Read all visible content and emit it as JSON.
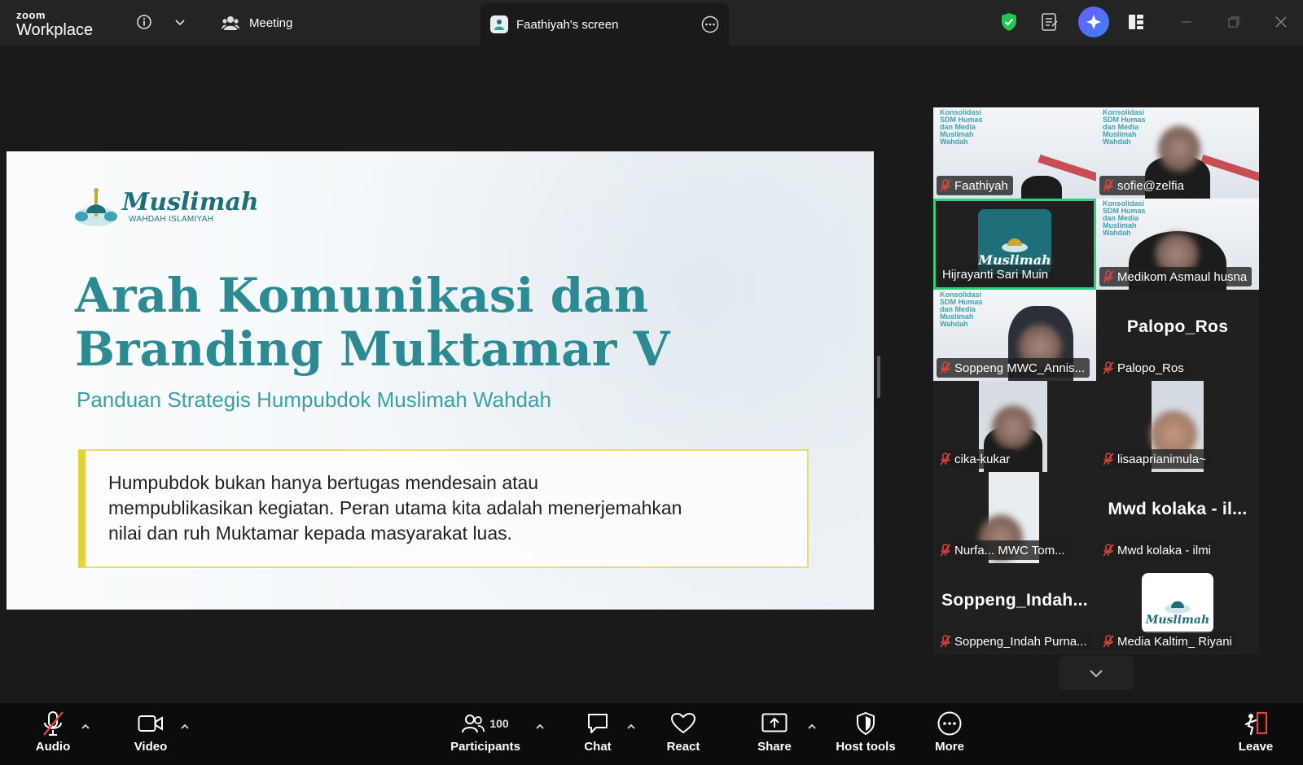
{
  "titlebar": {
    "brand_top": "zoom",
    "brand_bottom": "Workplace",
    "meeting_label": "Meeting",
    "screen_tab_label": "Faathiyah's screen"
  },
  "slide": {
    "logo_main": "Muslimah",
    "logo_sub": "WAHDAH ISLAMIYAH",
    "title_line1": "Arah Komunikasi dan",
    "title_line2": "Branding Muktamar V",
    "subtitle": "Panduan Strategis Humpubdok Muslimah Wahdah",
    "quote_line1": "Humpubdok bukan hanya bertugas mendesain atau",
    "quote_line2": "mempublikasikan kegiatan. Peran utama kita adalah menerjemahkan",
    "quote_line3": "nilai dan ruh Muktamar kepada masyarakat luas."
  },
  "banner_text": "Konsolidasi SDM Humas dan Media Muslimah Wahdah",
  "participants": [
    {
      "name": "Faathiyah"
    },
    {
      "name": "sofie@zelfia"
    },
    {
      "name": "Hijrayanti Sari Muin",
      "logo_text": "Muslimah"
    },
    {
      "name": "Medikom Asmaul husna"
    },
    {
      "name": "Soppeng MWC_Annis..."
    },
    {
      "name": "Palopo_Ros",
      "display": "Palopo_Ros"
    },
    {
      "name": "cika-kukar"
    },
    {
      "name": "lisaaprianimula~"
    },
    {
      "name": "Nurfa... MWC Tom..."
    },
    {
      "name": "Mwd kolaka - ilmi",
      "display": "Mwd kolaka - il..."
    },
    {
      "name": "Soppeng_Indah Purna...",
      "display": "Soppeng_Indah..."
    },
    {
      "name": "Media Kaltim_ Riyani",
      "logo_text": "Muslimah"
    }
  ],
  "toolbar": {
    "audio": "Audio",
    "video": "Video",
    "participants": "Participants",
    "participant_count": "100",
    "chat": "Chat",
    "react": "React",
    "share": "Share",
    "host_tools": "Host tools",
    "more": "More",
    "leave": "Leave"
  },
  "colors": {
    "accent_green": "#2fd17b",
    "teal": "#2b8a92",
    "leave_red": "#e0443e",
    "mute_red": "#e0443e"
  }
}
